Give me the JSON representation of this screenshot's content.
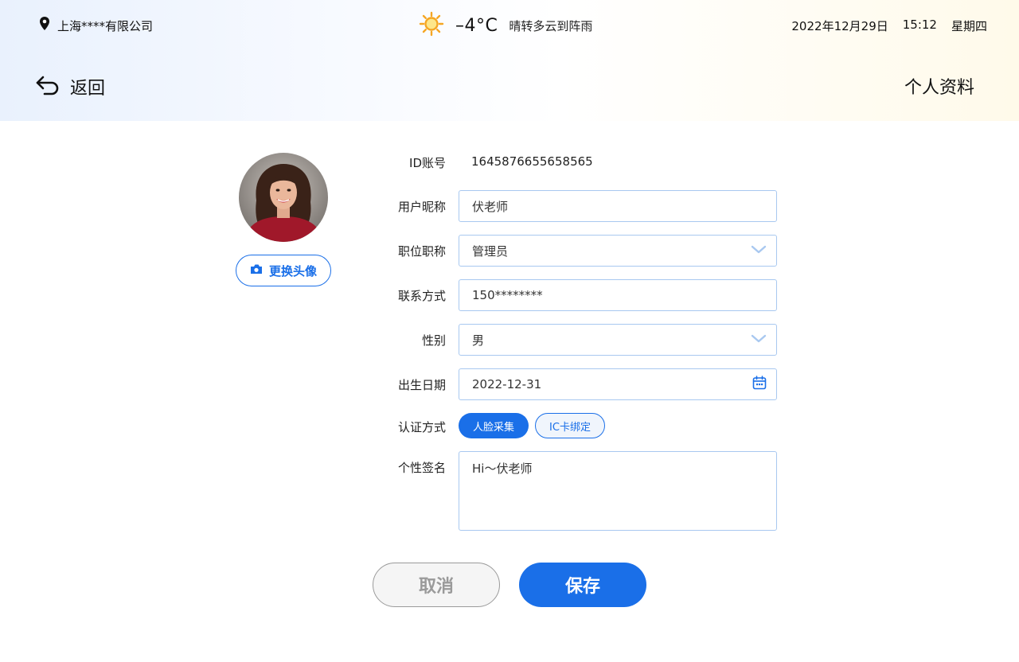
{
  "header": {
    "location": "上海****有限公司",
    "temperature": "–4°C",
    "weather_desc": "晴转多云到阵雨",
    "date": "2022年12月29日",
    "time": "15:12",
    "weekday": "星期四",
    "back_label": "返回",
    "page_title": "个人资料"
  },
  "profile": {
    "change_avatar_label": "更换头像",
    "id_label": "ID账号",
    "id_value": "1645876655658565",
    "nickname_label": "用户昵称",
    "nickname_value": "伏老师",
    "position_label": "职位职称",
    "position_value": "管理员",
    "contact_label": "联系方式",
    "contact_value": "150********",
    "gender_label": "性别",
    "gender_value": "男",
    "birth_label": "出生日期",
    "birth_value": "2022-12-31",
    "auth_label": "认证方式",
    "auth_options": [
      "人脸采集",
      "IC卡绑定"
    ],
    "signature_label": "个性签名",
    "signature_value": "Hi～伏老师"
  },
  "actions": {
    "cancel_label": "取消",
    "save_label": "保存"
  },
  "colors": {
    "accent": "#1a6fe8",
    "field_border": "#a8c8f0"
  },
  "icons": [
    "location-pin-icon",
    "sun-icon",
    "back-arrow-icon",
    "camera-icon",
    "chevron-down-icon",
    "calendar-icon"
  ]
}
